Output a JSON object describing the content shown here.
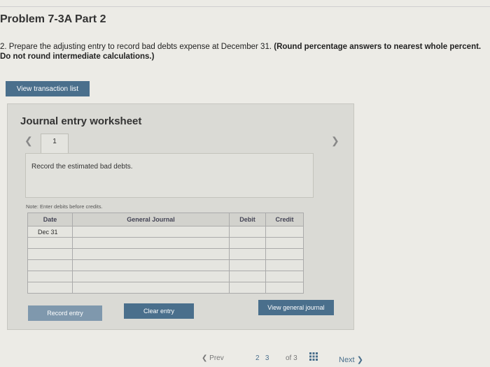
{
  "title": "Problem 7-3A Part 2",
  "instructions": {
    "prefix": "2. Prepare the adjusting entry to record bad debts expense at December 31.",
    "bold": "(Round percentage answers to nearest whole percent. Do not round intermediate calculations.)"
  },
  "buttons": {
    "view_transaction_list": "View transaction list",
    "record_entry": "Record entry",
    "clear_entry": "Clear entry",
    "view_general_journal": "View general journal"
  },
  "worksheet": {
    "title": "Journal entry worksheet",
    "tab_number": "1",
    "record_instruction": "Record the estimated bad debts.",
    "note": "Note: Enter debits before credits."
  },
  "journal": {
    "headers": [
      "Date",
      "General Journal",
      "Debit",
      "Credit"
    ],
    "rows": [
      {
        "date": "Dec 31",
        "account": "",
        "debit": "",
        "credit": ""
      },
      {
        "date": "",
        "account": "",
        "debit": "",
        "credit": ""
      },
      {
        "date": "",
        "account": "",
        "debit": "",
        "credit": ""
      },
      {
        "date": "",
        "account": "",
        "debit": "",
        "credit": ""
      },
      {
        "date": "",
        "account": "",
        "debit": "",
        "credit": ""
      },
      {
        "date": "",
        "account": "",
        "debit": "",
        "credit": ""
      }
    ]
  },
  "bottom_nav": {
    "prev": "Prev",
    "current_page": "2",
    "current_page_alt": "3",
    "of_label": "of 3",
    "next": "Next"
  }
}
